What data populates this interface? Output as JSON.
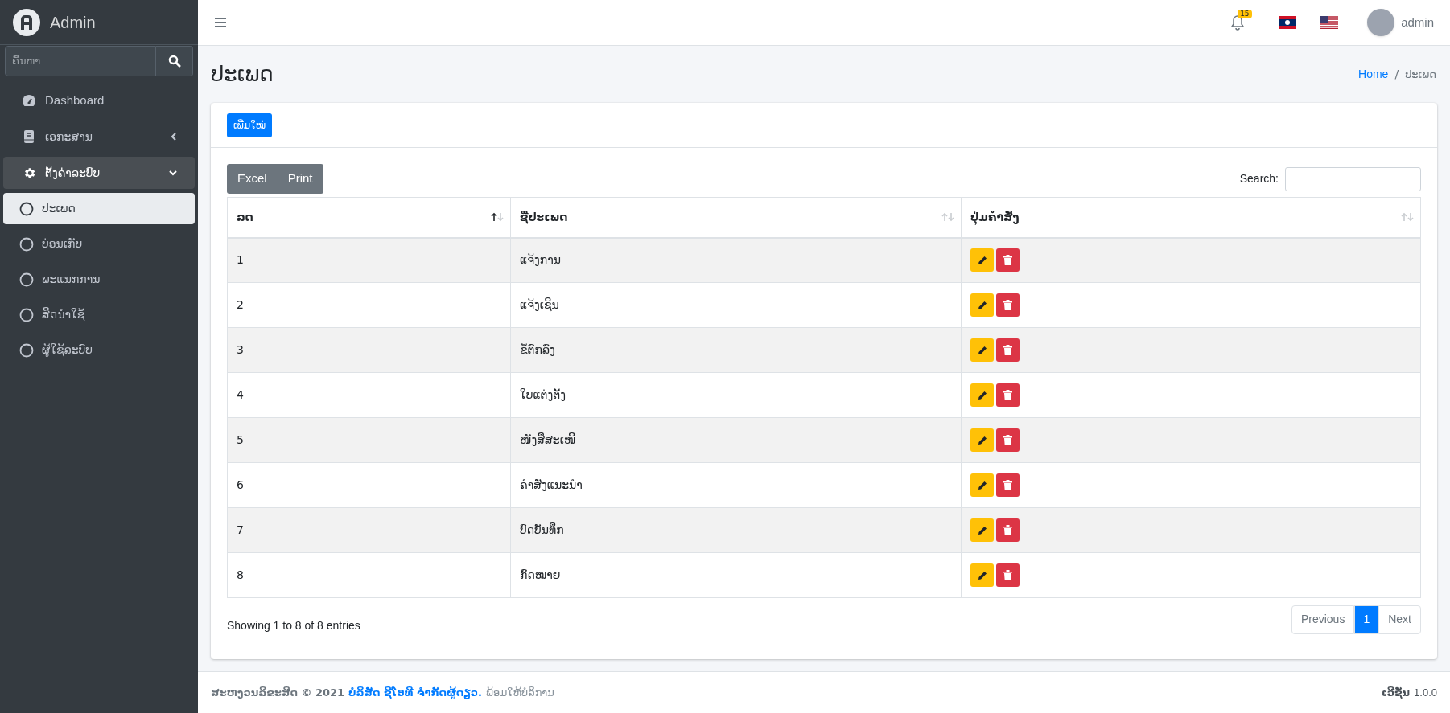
{
  "sidebar": {
    "brand": "Admin",
    "search": {
      "placeholder": "ຄົ້ນຫາ"
    },
    "items": [
      {
        "kind": "link",
        "label": "Dashboard"
      },
      {
        "kind": "group",
        "label": "ເອກະສານ",
        "expanded": false
      },
      {
        "kind": "group",
        "label": "ຕັ້ງຄ່າລະບົບ",
        "expanded": true,
        "children": [
          {
            "label": "ປະເພດ",
            "selected": true
          },
          {
            "label": "ບ່ອນເກັບ",
            "selected": false
          },
          {
            "label": "ພະແນກການ",
            "selected": false
          },
          {
            "label": "ສິດນຳໃຊ້",
            "selected": false
          },
          {
            "label": "ຜູ້ໃຊ້ລະບົບ",
            "selected": false
          }
        ]
      }
    ]
  },
  "topbar": {
    "notification_count": "15",
    "user": "admin"
  },
  "page": {
    "title": "ປະເພດ",
    "breadcrumb_separator": "/",
    "breadcrumb": [
      {
        "label": "Home",
        "link": true
      },
      {
        "label": "ປະເພດ",
        "link": false
      }
    ]
  },
  "card": {
    "add_button": "ເພີ່ມໃໝ່",
    "export_buttons": [
      "Excel",
      "Print"
    ],
    "search_label": "Search:",
    "table": {
      "columns": [
        {
          "label": "ລດ",
          "sorted": true
        },
        {
          "label": "ຊື່ປະເພດ",
          "sorted": false
        },
        {
          "label": "ປຸ່ມຄຳສັ່ງ",
          "sorted": false
        }
      ],
      "rows": [
        [
          "1",
          "ແຈ້ງການ"
        ],
        [
          "2",
          "ແຈ້ງເຊີນ"
        ],
        [
          "3",
          "ຂໍ້ຕົກລົງ"
        ],
        [
          "4",
          "ໃບແຕ່ງຕັ້ງ"
        ],
        [
          "5",
          "ໜັງສືສະເໜີ"
        ],
        [
          "6",
          "ຄຳສັ່ງແນະນຳ"
        ],
        [
          "7",
          "ບົດບັນທຶກ"
        ],
        [
          "8",
          "ກົດໝາຍ"
        ]
      ]
    },
    "info": "Showing 1 to 8 of 8 entries",
    "pagination": [
      {
        "label": "Previous",
        "kind": "nav",
        "selected": false
      },
      {
        "label": "1",
        "kind": "page",
        "selected": true
      },
      {
        "label": "Next",
        "kind": "nav",
        "selected": false
      }
    ]
  },
  "footer": {
    "copyright": "ສະຫງວນລິຂະສິດ © 2021",
    "company": "ບໍລິສັດ ຊີໂອທີ ຈຳກັດຜູ້ດຽວ.",
    "tagline": "ພ້ອມໃຫ້ບໍລິການ",
    "version_label": "ເວີຊັ່ນ",
    "version": "1.0.0"
  }
}
